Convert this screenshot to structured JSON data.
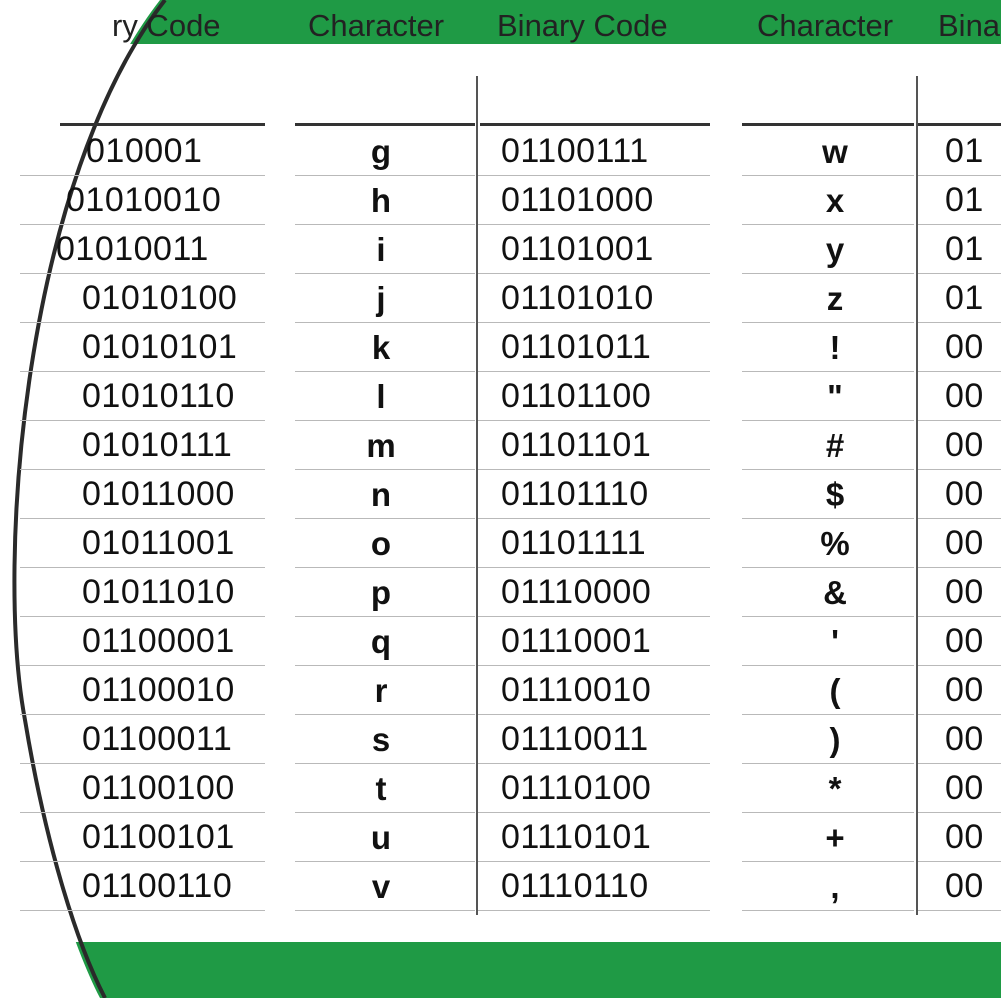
{
  "colors": {
    "accent_green": "#1f9a45",
    "rule": "#b9b9b9",
    "text": "#111111"
  },
  "headers": {
    "col1_binary": "ry Code",
    "col2_char": "Character",
    "col2_binary": "Binary Code",
    "col3_char": "Character",
    "col3_binary": "Bina"
  },
  "col1_binary": [
    "010001",
    "01010010",
    "01010011",
    "01010100",
    "01010101",
    "01010110",
    "01010111",
    "01011000",
    "01011001",
    "01011010",
    "01100001",
    "01100010",
    "01100011",
    "01100100",
    "01100101",
    "01100110"
  ],
  "col2_chars": [
    "g",
    "h",
    "i",
    "j",
    "k",
    "l",
    "m",
    "n",
    "o",
    "p",
    "q",
    "r",
    "s",
    "t",
    "u",
    "v"
  ],
  "col2_binary": [
    "01100111",
    "01101000",
    "01101001",
    "01101010",
    "01101011",
    "01101100",
    "01101101",
    "01101110",
    "01101111",
    "01110000",
    "01110001",
    "01110010",
    "01110011",
    "01110100",
    "01110101",
    "01110110"
  ],
  "col3_chars": [
    "w",
    "x",
    "y",
    "z",
    "!",
    "\"",
    "#",
    "$",
    "%",
    "&",
    "'",
    "(",
    ")",
    "*",
    "+",
    ","
  ],
  "col3_binary": [
    "01",
    "01",
    "01",
    "01",
    "00",
    "00",
    "00",
    "00",
    "00",
    "00",
    "00",
    "00",
    "00",
    "00",
    "00",
    "00"
  ]
}
